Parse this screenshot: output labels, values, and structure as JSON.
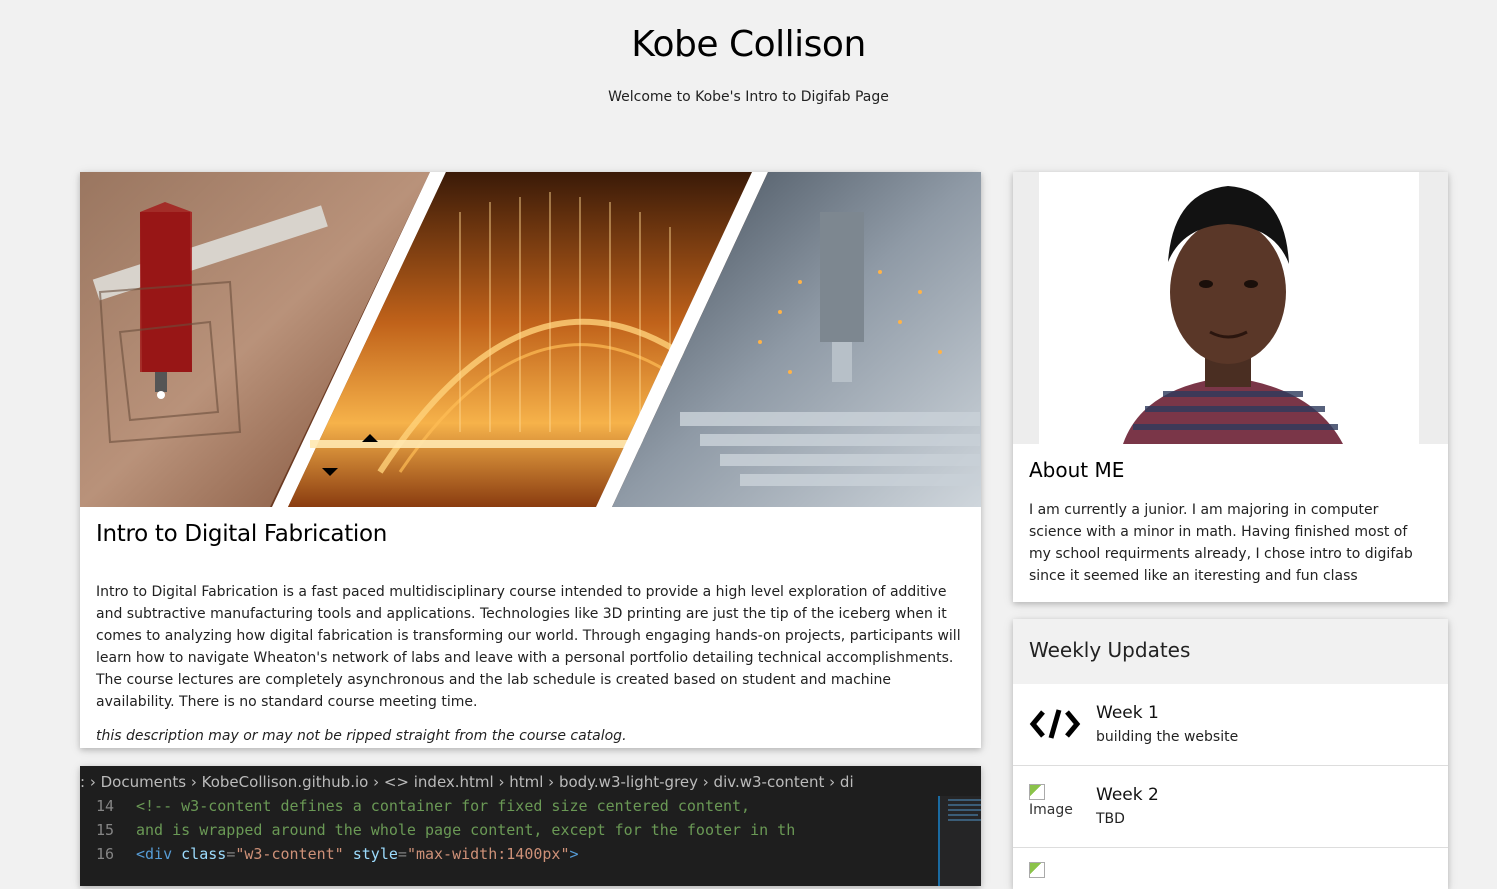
{
  "header": {
    "title": "Kobe Collison",
    "subtitle": "Welcome to Kobe's Intro to Digifab Page"
  },
  "main_card": {
    "image_alt": "digital fabrication collage",
    "title": "Intro to Digital Fabrication",
    "description": "Intro to Digital Fabrication is a fast paced multidisciplinary course intended to provide a high level exploration of additive and subtractive manufacturing tools and applications. Technologies like 3D printing are just the tip of the iceberg when it comes to analyzing how digital fabrication is transforming our world. Through engaging hands-on projects, participants will learn how to navigate Wheaton's network of labs and leave with a personal portfolio detailing technical accomplishments. The course lectures are completely asynchronous and the lab schedule is created based on student and machine availability. There is no standard course meeting time.",
    "note": "this description may or may not be ripped straight from the course catalog."
  },
  "code_card": {
    "breadcrumb": ": › Documents › KobeCollison.github.io › <> index.html › html › body.w3-light-grey › div.w3-content › di",
    "lines": [
      {
        "num": "14",
        "text": "<!-- w3-content defines a container for fixed size centered content,"
      },
      {
        "num": "15",
        "text": "and is wrapped around the whole page content, except for the footer in th"
      },
      {
        "num": "16",
        "tag_open": "<div",
        "attr": "class",
        "eq": "=",
        "val1": "\"w3-content\"",
        "attr2": "style",
        "val2": "\"max-width:1400px\"",
        "tag_close": ">"
      }
    ]
  },
  "about": {
    "title": "About ME",
    "text": "I am currently a junior. I am majoring in computer science with a minor in math. Having finished most of my school requirments already, I chose intro to digifab since it seemed like an iteresting and fun class"
  },
  "updates": {
    "title": "Weekly Updates",
    "items": [
      {
        "week": "Week 1",
        "desc": "building the website",
        "icon": "code-icon"
      },
      {
        "week": "Week 2",
        "desc": "TBD",
        "icon": "broken-image",
        "alt": "Image"
      }
    ]
  }
}
